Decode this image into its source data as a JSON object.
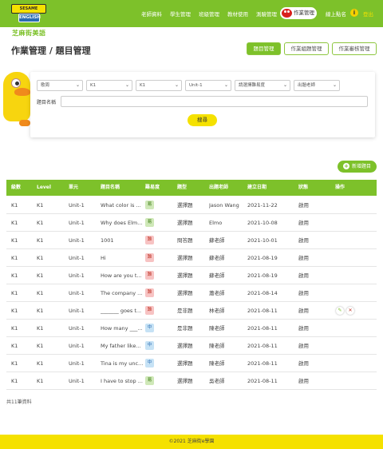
{
  "header": {
    "logo_top": "SESAME STREET",
    "logo_bottom": "ENGLISH",
    "logo_sub": "芝麻街美語",
    "nav": [
      "老師資料",
      "學生管理",
      "班級管理",
      "教材使用",
      "測驗管理"
    ],
    "nav_active": "作業管理",
    "online": "線上點名",
    "info": "i",
    "logout": "登出"
  },
  "page": {
    "title": "作業管理 / 題目管理",
    "tabs": [
      "題目管理",
      "作業組題管理",
      "作業審核管理"
    ]
  },
  "filters": {
    "selects": [
      "歌周",
      "K1",
      "K1",
      "Unit-1",
      "請選擇難易度",
      "出題老師"
    ],
    "name_label": "題目名稱",
    "name_value": "",
    "search_label": "搜尋"
  },
  "add_label": "新增題目",
  "table": {
    "headers": [
      "級數",
      "Level",
      "單元",
      "題目名稱",
      "難易度",
      "題型",
      "出題老師",
      "建立日期",
      "狀態",
      "操作"
    ],
    "rows": [
      {
        "grade": "K1",
        "level": "K1",
        "unit": "Unit-1",
        "name": "What color is ...",
        "difficulty": "易",
        "type": "選擇題",
        "teacher": "Jason Wang",
        "date": "2021-11-22",
        "status": "啟用"
      },
      {
        "grade": "K1",
        "level": "K1",
        "unit": "Unit-1",
        "name": "Why does Elm...",
        "difficulty": "易",
        "type": "選擇題",
        "teacher": "Elmo",
        "date": "2021-10-08",
        "status": "啟用"
      },
      {
        "grade": "K1",
        "level": "K1",
        "unit": "Unit-1",
        "name": "1001",
        "difficulty": "難",
        "type": "問答題",
        "teacher": "蘇老師",
        "date": "2021-10-01",
        "status": "啟用"
      },
      {
        "grade": "K1",
        "level": "K1",
        "unit": "Unit-1",
        "name": "Hi",
        "difficulty": "難",
        "type": "選擇題",
        "teacher": "蘇老師",
        "date": "2021-08-19",
        "status": "啟用"
      },
      {
        "grade": "K1",
        "level": "K1",
        "unit": "Unit-1",
        "name": "How are you t...",
        "difficulty": "難",
        "type": "選擇題",
        "teacher": "蘇老師",
        "date": "2021-08-19",
        "status": "啟用"
      },
      {
        "grade": "K1",
        "level": "K1",
        "unit": "Unit-1",
        "name": "The company ...",
        "difficulty": "難",
        "type": "選擇題",
        "teacher": "蕭老師",
        "date": "2021-08-14",
        "status": "啟用"
      },
      {
        "grade": "K1",
        "level": "K1",
        "unit": "Unit-1",
        "name": "_______ goes t...",
        "difficulty": "難",
        "type": "是非題",
        "teacher": "林老師",
        "date": "2021-08-11",
        "status": "啟用"
      },
      {
        "grade": "K1",
        "level": "K1",
        "unit": "Unit-1",
        "name": "How many ___...",
        "difficulty": "中",
        "type": "是非題",
        "teacher": "陳老師",
        "date": "2021-08-11",
        "status": "啟用"
      },
      {
        "grade": "K1",
        "level": "K1",
        "unit": "Unit-1",
        "name": "My father like...",
        "difficulty": "中",
        "type": "選擇題",
        "teacher": "陳老師",
        "date": "2021-08-11",
        "status": "啟用"
      },
      {
        "grade": "K1",
        "level": "K1",
        "unit": "Unit-1",
        "name": "Tina is my unc...",
        "difficulty": "中",
        "type": "選擇題",
        "teacher": "陳老師",
        "date": "2021-08-11",
        "status": "啟用"
      },
      {
        "grade": "K1",
        "level": "K1",
        "unit": "Unit-1",
        "name": "I have to stop ...",
        "difficulty": "易",
        "type": "選擇題",
        "teacher": "吳老師",
        "date": "2021-08-11",
        "status": "啟用"
      }
    ],
    "action_edit_icon": "✎",
    "action_delete_icon": "✕"
  },
  "total": "共11筆資料",
  "footer": "©2021 芝麻街e學園",
  "colors": {
    "green": "#7dc12a",
    "yellow": "#f5e100",
    "easy_bg": "#cfe8b8",
    "easy_fg": "#3b7a12",
    "hard_bg": "#f7c3c3",
    "hard_fg": "#c0392b",
    "mid_bg": "#c6e2f5",
    "mid_fg": "#2b6db3"
  }
}
